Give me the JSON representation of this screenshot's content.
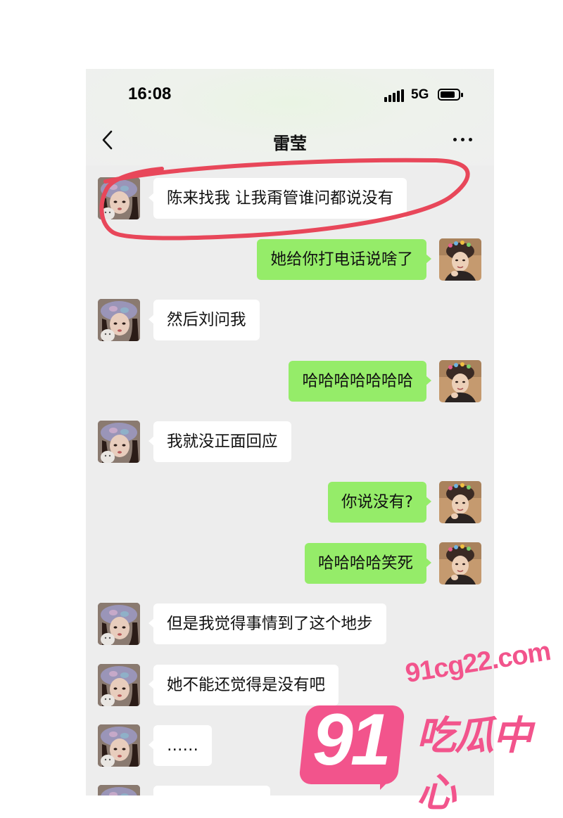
{
  "status_bar": {
    "time": "16:08",
    "network": "5G"
  },
  "header": {
    "title": "雷莹"
  },
  "icons": {
    "back": "chevron-left-icon",
    "more": "more-horizontal-icon",
    "signal": "signal-bars-icon",
    "battery": "battery-icon"
  },
  "colors": {
    "sent_bubble": "#95ec69",
    "received_bubble": "#ffffff",
    "chat_background": "#ededed",
    "annotation_circle": "#e8475a",
    "watermark": "#f2548c"
  },
  "messages": [
    {
      "side": "left",
      "text": "陈来找我 让我甭管谁问都说没有"
    },
    {
      "side": "right",
      "text": "她给你打电话说啥了"
    },
    {
      "side": "left",
      "text": "然后刘问我"
    },
    {
      "side": "right",
      "text": "哈哈哈哈哈哈哈"
    },
    {
      "side": "left",
      "text": "我就没正面回应"
    },
    {
      "side": "right",
      "text": "你说没有?"
    },
    {
      "side": "right",
      "text": "哈哈哈哈笑死"
    },
    {
      "side": "left",
      "text": "但是我觉得事情到了这个地步"
    },
    {
      "side": "left",
      "text": "她不能还觉得是没有吧"
    },
    {
      "side": "left",
      "text": "……"
    },
    {
      "side": "left",
      "text": ""
    }
  ],
  "watermark": {
    "url": "91cg22.com",
    "number": "91",
    "name": "吃瓜中心"
  }
}
